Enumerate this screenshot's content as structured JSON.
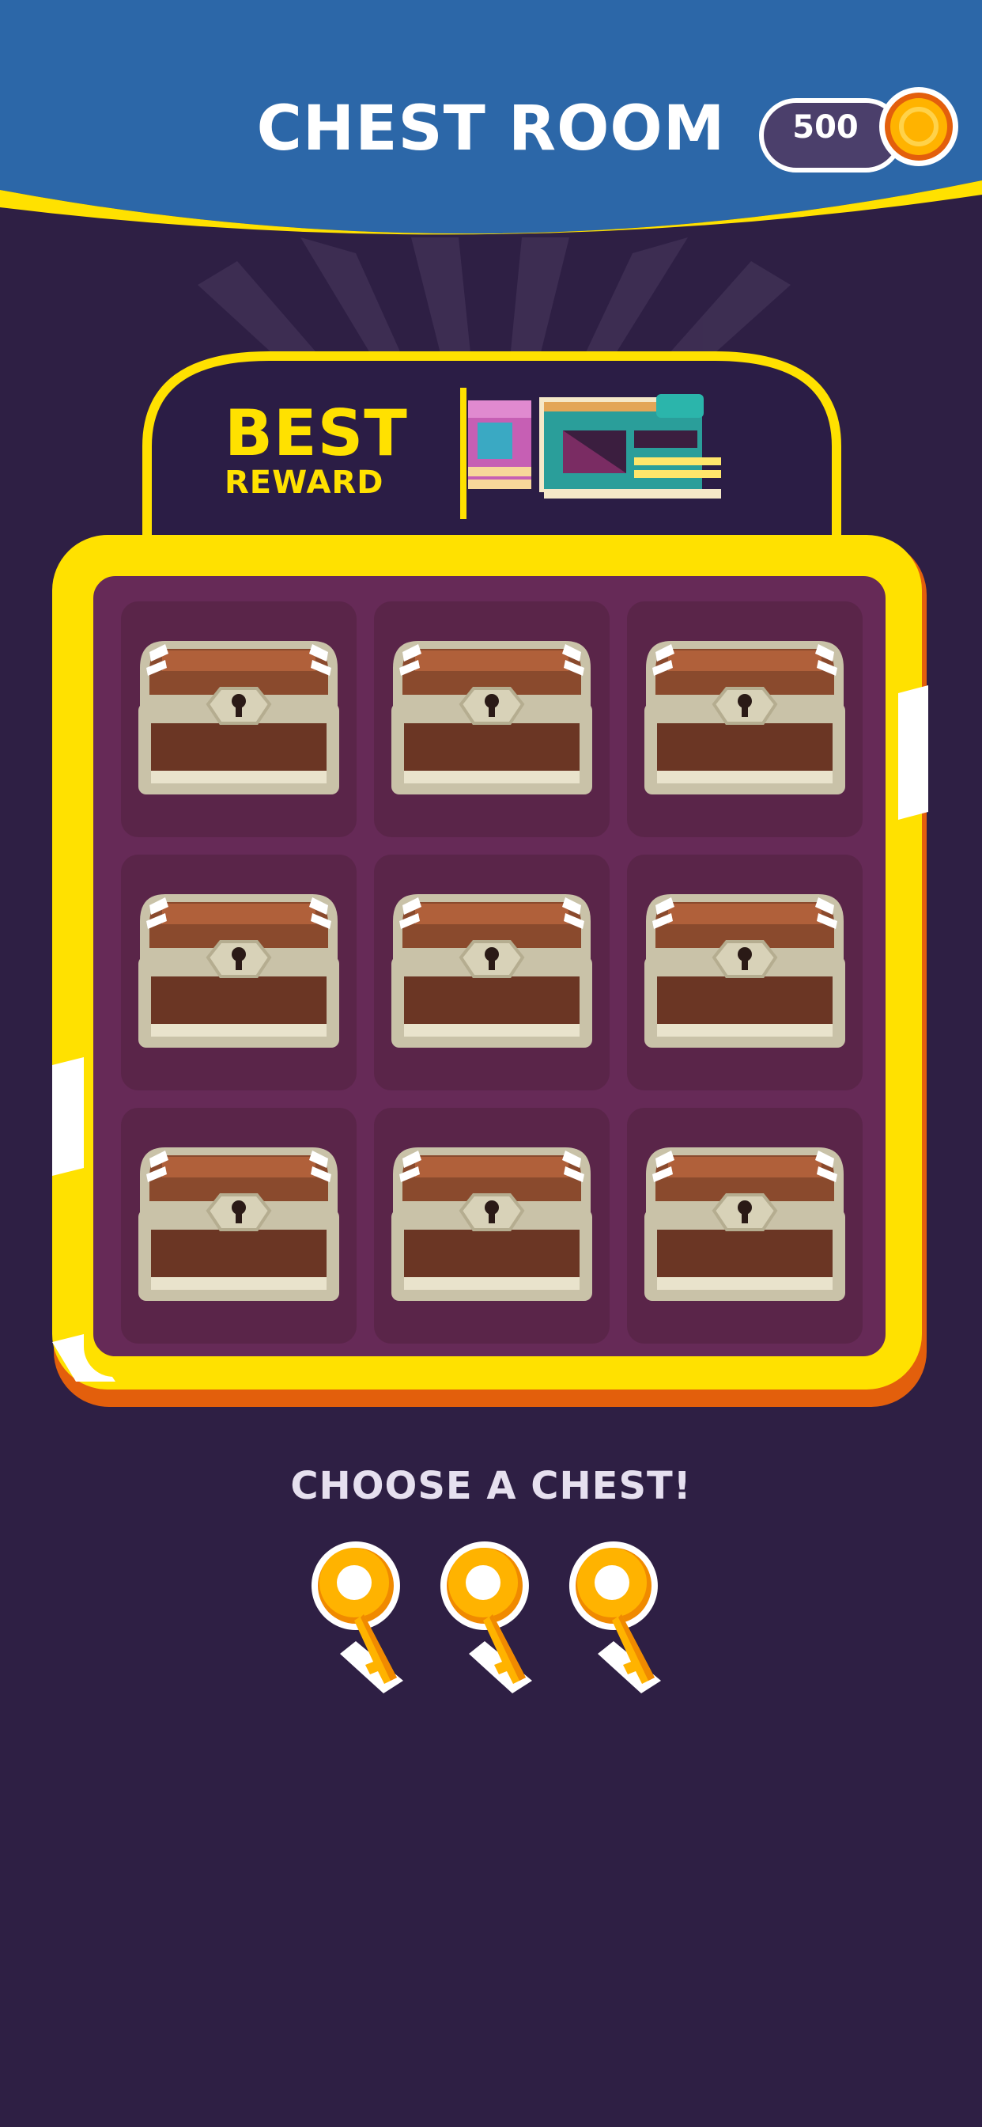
{
  "header": {
    "title": "CHEST ROOM",
    "coins": "500"
  },
  "best_reward": {
    "line1": "BEST",
    "line2": "REWARD",
    "item_icon": "train-car-icon"
  },
  "chest_grid": {
    "rows": 3,
    "columns": 3,
    "chests": [
      {
        "state": "locked"
      },
      {
        "state": "locked"
      },
      {
        "state": "locked"
      },
      {
        "state": "locked"
      },
      {
        "state": "locked"
      },
      {
        "state": "locked"
      },
      {
        "state": "locked"
      },
      {
        "state": "locked"
      },
      {
        "state": "locked"
      }
    ]
  },
  "prompt": "CHOOSE A CHEST!",
  "keys": {
    "count": 3,
    "icon": "key-icon"
  },
  "colors": {
    "header_blue": "#2c67a8",
    "background": "#2e1f44",
    "accent_yellow": "#ffe100",
    "frame_orange": "#e35f0c",
    "panel_maroon": "#662a57",
    "cell_maroon": "#5a2549",
    "coin_gold": "#ffb300"
  }
}
